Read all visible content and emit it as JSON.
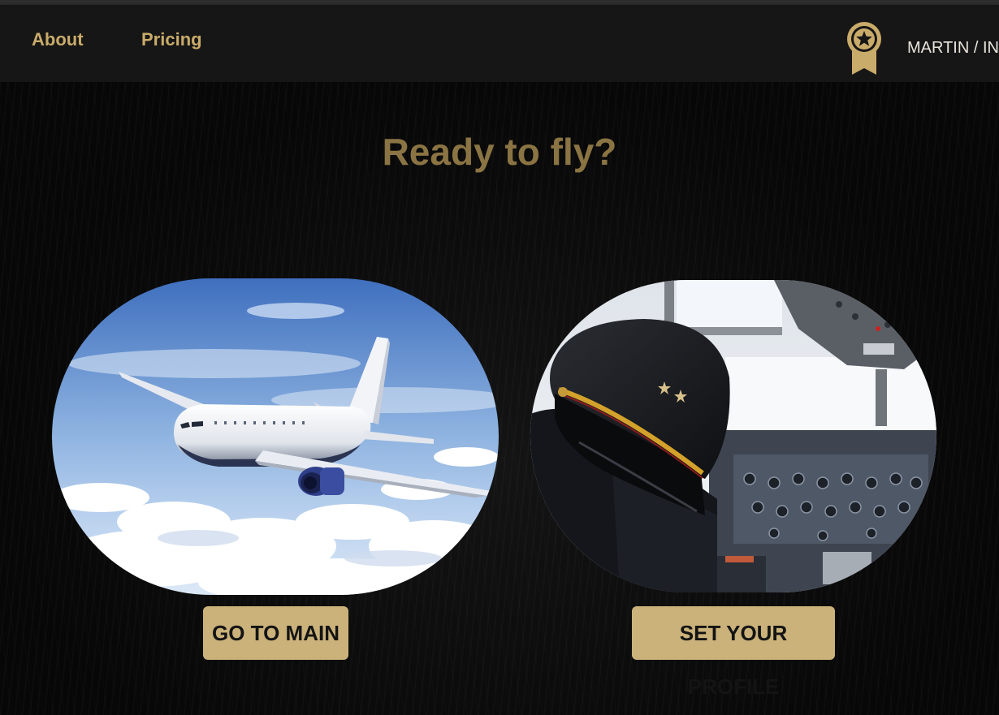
{
  "nav": {
    "about_label": "About",
    "pricing_label": "Pricing",
    "user_label": "MARTIN / INS"
  },
  "hero": {
    "title": "Ready to fly?"
  },
  "cards": {
    "main_button_label": "GO TO MAIN",
    "profile_button_label": "SET YOUR PROFILE"
  },
  "icons": {
    "badge": "award-ribbon-star-icon"
  },
  "colors": {
    "accent_gold": "#c9ab6a",
    "button_gold": "#cbb27a",
    "title_gold": "#8b7443",
    "navbar": "#161616",
    "background": "#070707"
  }
}
